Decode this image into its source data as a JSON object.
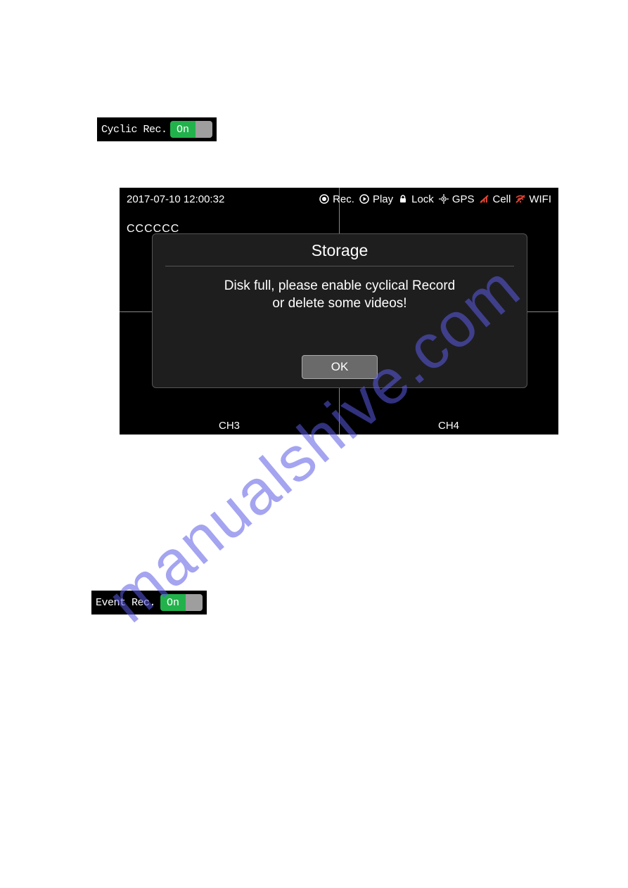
{
  "watermark": "manualshive.com",
  "cyclic_toggle": {
    "label": "Cyclic Rec.",
    "state": "On"
  },
  "event_toggle": {
    "label": "Event Rec.",
    "state": "On"
  },
  "screen": {
    "timestamp": "2017-07-10 12:00:32",
    "plate": "CCCCCC",
    "topbar": {
      "rec": "Rec.",
      "play": "Play",
      "lock": "Lock",
      "gps": "GPS",
      "cell": "Cell",
      "wifi": "WIFI"
    },
    "channels": {
      "ch3": "CH3",
      "ch4": "CH4"
    }
  },
  "dialog": {
    "title": "Storage",
    "message_line1": "Disk full, please enable cyclical Record",
    "message_line2": "or delete some videos!",
    "ok": "OK"
  }
}
